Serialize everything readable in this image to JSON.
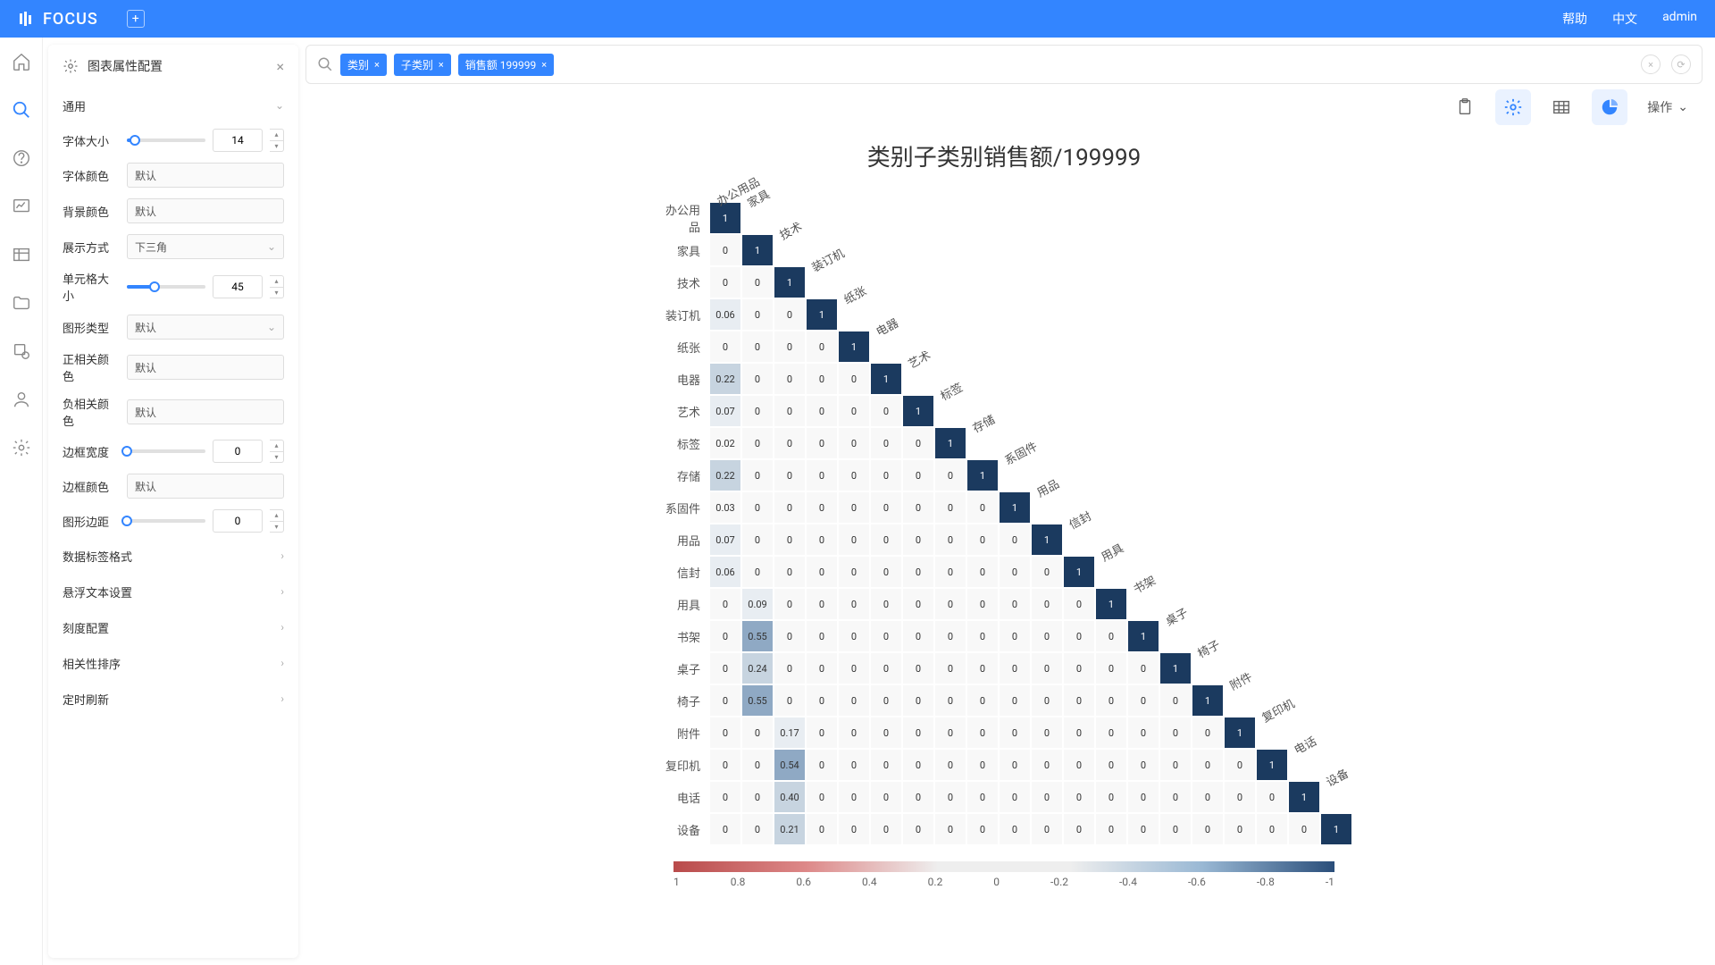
{
  "header": {
    "brand": "FOCUS",
    "help": "帮助",
    "lang": "中文",
    "user": "admin"
  },
  "config": {
    "title": "图表属性配置",
    "sections": {
      "general": "通用",
      "font_size": {
        "label": "字体大小",
        "value": "14"
      },
      "font_color": {
        "label": "字体颜色",
        "value": "默认"
      },
      "bg_color": {
        "label": "背景颜色",
        "value": "默认"
      },
      "display": {
        "label": "展示方式",
        "value": "下三角"
      },
      "cell_size": {
        "label": "单元格大小",
        "value": "45"
      },
      "shape": {
        "label": "图形类型",
        "value": "默认"
      },
      "pos_color": {
        "label": "正相关颜色",
        "value": "默认"
      },
      "neg_color": {
        "label": "负相关颜色",
        "value": "默认"
      },
      "border_w": {
        "label": "边框宽度",
        "value": "0"
      },
      "border_c": {
        "label": "边框颜色",
        "value": "默认"
      },
      "margin": {
        "label": "图形边距",
        "value": "0"
      },
      "data_label": "数据标签格式",
      "tooltip": "悬浮文本设置",
      "scale": "刻度配置",
      "sort": "相关性排序",
      "refresh": "定时刷新"
    }
  },
  "search": {
    "tags": [
      "类别",
      "子类别",
      "销售额 199999"
    ]
  },
  "toolbar": {
    "action": "操作"
  },
  "chart_data": {
    "type": "heatmap",
    "title": "类别子类别销售额/199999",
    "categories": [
      "办公用品",
      "家具",
      "技术",
      "装订机",
      "纸张",
      "电器",
      "艺术",
      "标签",
      "存储",
      "系固件",
      "用品",
      "信封",
      "用具",
      "书架",
      "桌子",
      "椅子",
      "附件",
      "复印机",
      "电话",
      "设备"
    ],
    "matrix": [
      [
        1
      ],
      [
        0,
        1
      ],
      [
        0,
        0,
        1
      ],
      [
        0.06,
        0,
        0,
        1
      ],
      [
        0,
        0,
        0,
        0,
        1
      ],
      [
        0.22,
        0,
        0,
        0,
        0,
        1
      ],
      [
        0.07,
        0,
        0,
        0,
        0,
        0,
        1
      ],
      [
        0.02,
        0,
        0,
        0,
        0,
        0,
        0,
        1
      ],
      [
        0.22,
        0,
        0,
        0,
        0,
        0,
        0,
        0,
        1
      ],
      [
        0.03,
        0,
        0,
        0,
        0,
        0,
        0,
        0,
        0,
        1
      ],
      [
        0.07,
        0,
        0,
        0,
        0,
        0,
        0,
        0,
        0,
        0,
        1
      ],
      [
        0.06,
        0,
        0,
        0,
        0,
        0,
        0,
        0,
        0,
        0,
        0,
        1
      ],
      [
        0,
        0.09,
        0,
        0,
        0,
        0,
        0,
        0,
        0,
        0,
        0,
        0,
        1
      ],
      [
        0,
        0.55,
        0,
        0,
        0,
        0,
        0,
        0,
        0,
        0,
        0,
        0,
        0,
        1
      ],
      [
        0,
        0.24,
        0,
        0,
        0,
        0,
        0,
        0,
        0,
        0,
        0,
        0,
        0,
        0,
        1
      ],
      [
        0,
        0.55,
        0,
        0,
        0,
        0,
        0,
        0,
        0,
        0,
        0,
        0,
        0,
        0,
        0,
        1
      ],
      [
        0,
        0,
        0.17,
        0,
        0,
        0,
        0,
        0,
        0,
        0,
        0,
        0,
        0,
        0,
        0,
        0,
        1
      ],
      [
        0,
        0,
        0.54,
        0,
        0,
        0,
        0,
        0,
        0,
        0,
        0,
        0,
        0,
        0,
        0,
        0,
        0,
        1
      ],
      [
        0,
        0,
        0.4,
        0,
        0,
        0,
        0,
        0,
        0,
        0,
        0,
        0,
        0,
        0,
        0,
        0,
        0,
        0,
        1
      ],
      [
        0,
        0,
        0.21,
        0,
        0,
        0,
        0,
        0,
        0,
        0,
        0,
        0,
        0,
        0,
        0,
        0,
        0,
        0,
        0,
        1
      ]
    ],
    "legend_ticks": [
      "1",
      "0.8",
      "0.6",
      "0.4",
      "0.2",
      "0",
      "-0.2",
      "-0.4",
      "-0.6",
      "-0.8",
      "-1"
    ]
  }
}
